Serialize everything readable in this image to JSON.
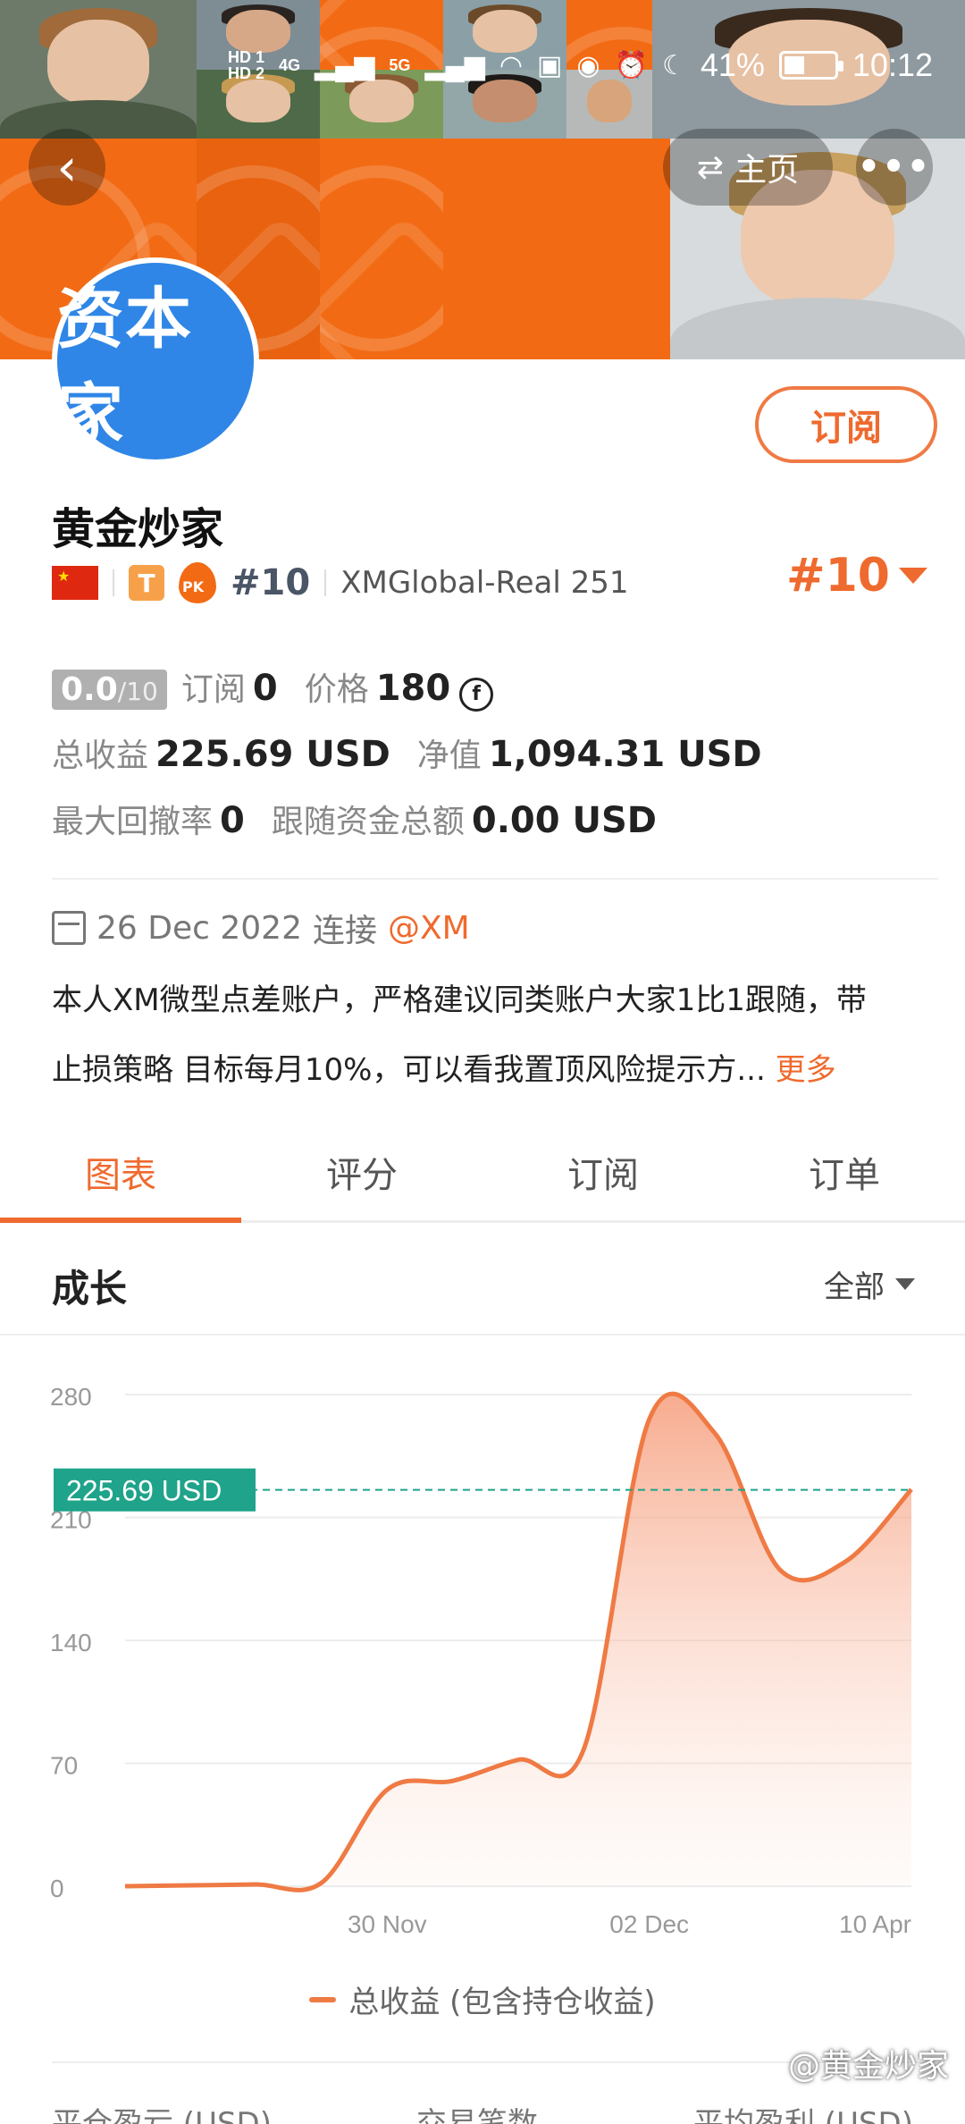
{
  "status_bar": {
    "sim1": "HD 1",
    "sim2": "HD 2",
    "net1": "4G",
    "net2": "5G",
    "battery_percent": "41%",
    "battery_level": 0.41,
    "time": "10:12"
  },
  "header": {
    "back_icon": "chevron-left-icon",
    "home_label": "主页",
    "more_icon": "more-icon",
    "avatar_text": "资本家",
    "subscribe_label": "订阅"
  },
  "profile": {
    "name": "黄金炒家",
    "badge_t": "T",
    "pk_label": "PK",
    "rank_small": "#10",
    "broker": "XMGlobal-Real 251",
    "rank_big": "#10"
  },
  "stats": {
    "score": "0.0",
    "score_den": "/10",
    "subscribe_label": "订阅",
    "subscribe_value": "0",
    "price_label": "价格",
    "price_value": "180",
    "total_profit_label": "总收益",
    "total_profit_value": "225.69 USD",
    "net_value_label": "净值",
    "net_value_value": "1,094.31 USD",
    "max_drawdown_label": "最大回撤率",
    "max_drawdown_value": "0",
    "follow_total_label": "跟随资金总额",
    "follow_total_value": "0.00 USD"
  },
  "info": {
    "date": "26 Dec 2022",
    "connect_label": "连接",
    "broker_tag": "@XM",
    "description_line1": "本人XM微型点差账户，严格建议同类账户大家1比1跟随，带",
    "description_line2": "止损策略 目标每月10%，可以看我置顶风险提示方...",
    "more_label": "更多"
  },
  "tabs": [
    {
      "label": "图表",
      "active": true
    },
    {
      "label": "评分",
      "active": false
    },
    {
      "label": "订阅",
      "active": false
    },
    {
      "label": "订单",
      "active": false
    }
  ],
  "growth": {
    "title": "成长",
    "filter_label": "全部"
  },
  "chart_data": {
    "type": "area",
    "y_ticks": [
      "280",
      "210",
      "140",
      "70",
      "0"
    ],
    "ylim": [
      0,
      280
    ],
    "x_tick_labels": [
      "30 Nov",
      "02 Dec",
      "10 Apr"
    ],
    "current_value_label": "225.69 USD",
    "current_value": 225.69,
    "series": [
      {
        "name": "总收益 (包含持仓收益)",
        "values": [
          0,
          0.5,
          1,
          2,
          55,
          60,
          72,
          78,
          266,
          258,
          180,
          185,
          226
        ]
      }
    ],
    "color": "#ef7a44",
    "grid": true
  },
  "legend_label": "总收益 (包含持仓收益)",
  "bottom_stats": {
    "label1": "平仓盈亏 (USD)",
    "label2": "交易笔数",
    "label3": "平均盈利 (USD)"
  },
  "watermark": "@黄金炒家"
}
